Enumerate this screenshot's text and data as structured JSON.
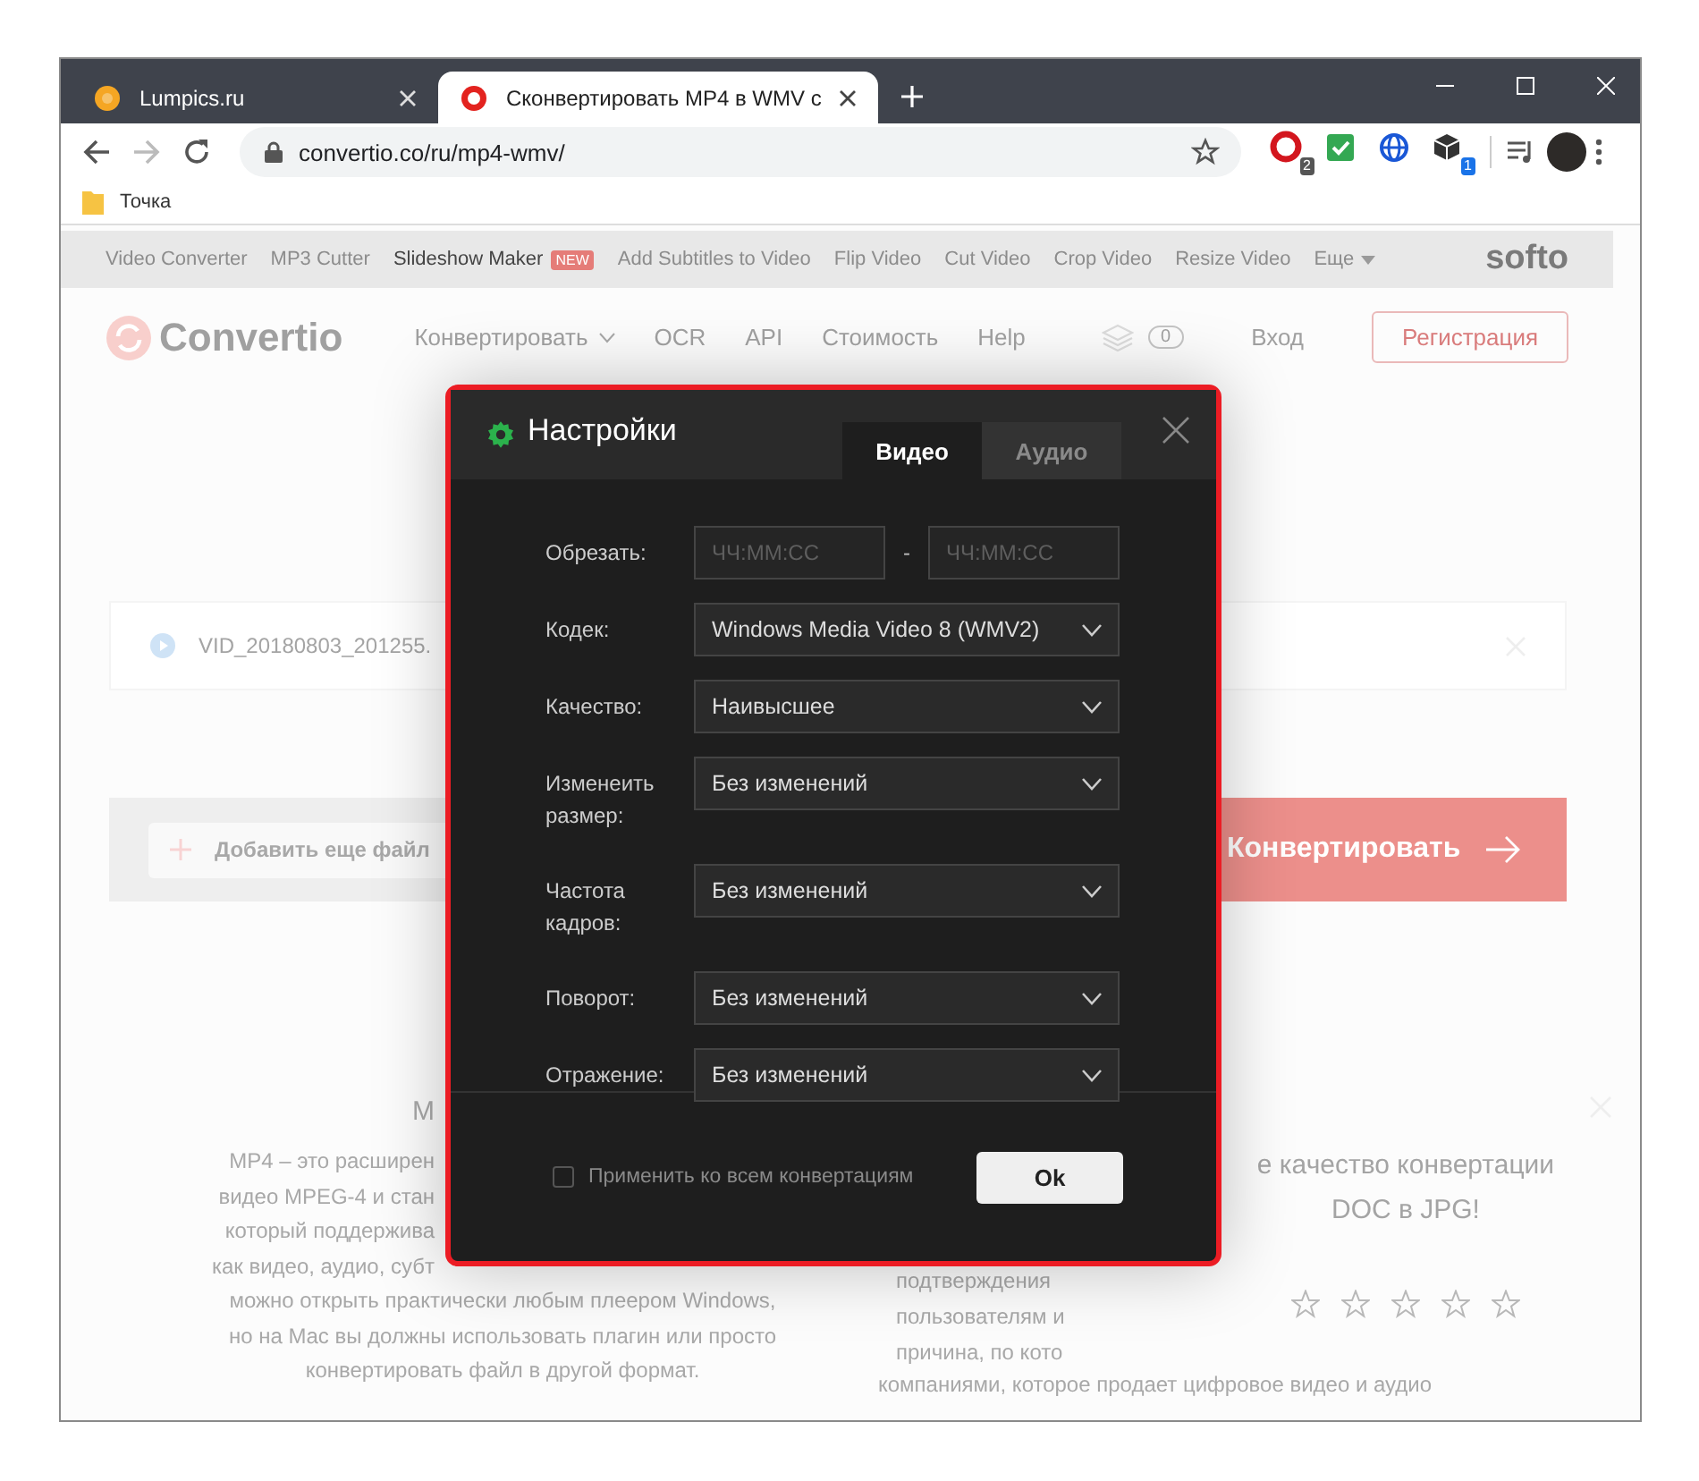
{
  "browser": {
    "tabs": [
      {
        "title": "Lumpics.ru",
        "selected": false
      },
      {
        "title": "Сконвертировать MP4 в WMV с",
        "selected": true
      }
    ],
    "forward_disabled": true,
    "address": "convertio.co/ru/mp4-wmv/",
    "extensions": [
      {
        "kind": "opera",
        "badge": "2"
      },
      {
        "kind": "check"
      },
      {
        "kind": "globe"
      },
      {
        "kind": "cube",
        "badge": "1"
      }
    ],
    "bookmarks": [
      "Точка"
    ]
  },
  "site": {
    "top_nav": [
      {
        "label": "Video Converter",
        "highlighted": false
      },
      {
        "label": "MP3 Cutter",
        "highlighted": false
      },
      {
        "label": "Slideshow Maker",
        "highlighted": true,
        "badge": "NEW"
      },
      {
        "label": "Add Subtitles to Video",
        "highlighted": false
      },
      {
        "label": "Flip Video",
        "highlighted": false
      },
      {
        "label": "Cut Video",
        "highlighted": false
      },
      {
        "label": "Crop Video",
        "highlighted": false
      },
      {
        "label": "Resize Video",
        "highlighted": false
      },
      {
        "label": "Еще",
        "highlighted": false,
        "dropdown": true
      }
    ],
    "top_logo": "softo",
    "header": {
      "logo": "Convertio",
      "menu": [
        {
          "label": "Конвертировать",
          "dropdown": true
        },
        {
          "label": "OCR",
          "dropdown": false
        },
        {
          "label": "API",
          "dropdown": false
        },
        {
          "label": "Стоимость",
          "dropdown": false
        },
        {
          "label": "Help",
          "dropdown": false
        }
      ],
      "layers_count": "0",
      "login": "Вход",
      "signup": "Регистрация"
    },
    "file_name": "VID_20180803_201255.",
    "add_files": "Добавить еще файл",
    "convert": "Конвертировать",
    "info": {
      "heading": "M",
      "lines": [
        "MP4 – это расширен",
        "видео MPEG-4 и стан",
        "который поддержива",
        "как видео, аудио, субт",
        "можно открыть практически любым плеером Windows,",
        "но на Mac вы должны использовать плагин или просто",
        "конвертировать файл в другой формат."
      ]
    },
    "middle_lines": [
      "подтверждения",
      "пользователям и",
      "причина, по кото"
    ],
    "rating": {
      "lines": [
        "е качество конвертации",
        "DOC в JPG!"
      ],
      "stars": 0
    },
    "bottom_lines": [
      "компаниями, которое продает цифровое видео и аудио"
    ]
  },
  "dialog": {
    "title": "Настройки",
    "tabs": [
      {
        "label": "Видео",
        "selected": true
      },
      {
        "label": "Аудио",
        "selected": false
      }
    ],
    "rows": [
      {
        "kind": "range",
        "label": "Обрезать:",
        "from_placeholder": "ЧЧ:ММ:СС",
        "separator": "-",
        "to_placeholder": "ЧЧ:ММ:СС"
      },
      {
        "kind": "select",
        "label": "Кодек:",
        "value": "Windows Media Video 8 (WMV2)"
      },
      {
        "kind": "select",
        "label": "Качество:",
        "value": "Наивысшее"
      },
      {
        "kind": "select",
        "label": "Изменеить размер:",
        "value": "Без изменений"
      },
      {
        "kind": "select",
        "label": "Частота кадров:",
        "value": "Без изменений"
      },
      {
        "kind": "select",
        "label": "Поворот:",
        "value": "Без изменений"
      },
      {
        "kind": "select",
        "label": "Отражение:",
        "value": "Без изменений"
      }
    ],
    "apply_all": {
      "label": "Применить ко всем конвертациям",
      "checked": false
    },
    "ok": "Ok"
  }
}
